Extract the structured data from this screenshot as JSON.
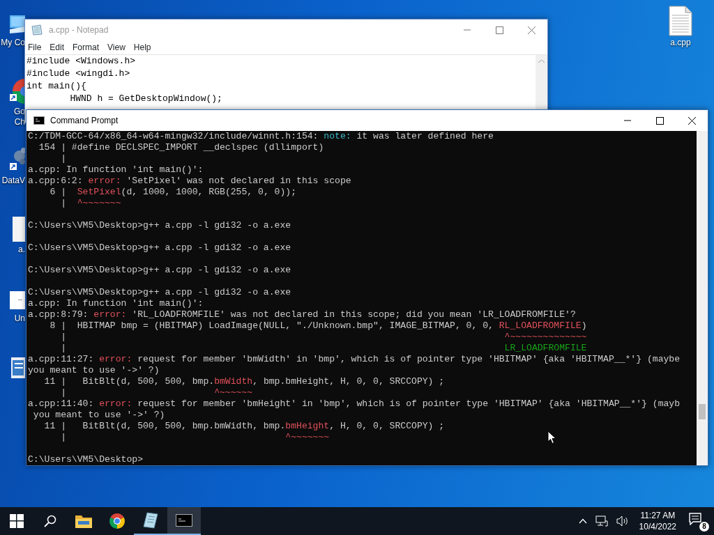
{
  "desktop_icons": [
    {
      "kind": "computer",
      "label_lines": [
        "My Co"
      ]
    },
    {
      "kind": "browser",
      "label_lines": [
        "Go",
        "Ch"
      ]
    },
    {
      "kind": "app",
      "label_lines": [
        "DataV"
      ]
    },
    {
      "kind": "file",
      "label_lines": [
        "a."
      ]
    },
    {
      "kind": "blank",
      "label_lines": [
        "Un"
      ]
    },
    {
      "kind": "doc"
    }
  ],
  "desktop_file": {
    "kind": "file",
    "label": "a.cpp"
  },
  "notepad": {
    "title": "a.cpp - Notepad",
    "menu": [
      "File",
      "Edit",
      "Format",
      "View",
      "Help"
    ],
    "lines": [
      "#include <Windows.h>",
      "#include <wingdi.h>",
      "int main(){",
      "        HWND h = GetDesktopWindow();"
    ]
  },
  "console": {
    "title": "Command Prompt",
    "lines": [
      {
        "kind": "text",
        "segments": [
          {
            "kind": "plain",
            "text": "C:/TDM-GCC-64/x86_64-w64-mingw32/include/winnt.h:154: "
          },
          {
            "kind": "note",
            "text": "note:"
          },
          {
            "kind": "plain",
            "text": " it was later defined here"
          }
        ]
      },
      {
        "kind": "text",
        "segments": [
          {
            "kind": "plain",
            "text": "  154 | #define DECLSPEC_IMPORT __declspec (dllimport)"
          }
        ]
      },
      {
        "kind": "text",
        "segments": [
          {
            "kind": "plain",
            "text": "      |"
          }
        ]
      },
      {
        "kind": "text",
        "segments": [
          {
            "kind": "plain",
            "text": "a.cpp: In function 'int main()':"
          }
        ]
      },
      {
        "kind": "text",
        "segments": [
          {
            "kind": "plain",
            "text": "a.cpp:6:2: "
          },
          {
            "kind": "error",
            "text": "error:"
          },
          {
            "kind": "plain",
            "text": " 'SetPixel' was not declared in this scope"
          }
        ]
      },
      {
        "kind": "text",
        "segments": [
          {
            "kind": "plain",
            "text": "    6 |  "
          },
          {
            "kind": "error",
            "text": "SetPixel"
          },
          {
            "kind": "plain",
            "text": "(d, 1000, 1000, RGB(255, 0, 0));"
          }
        ]
      },
      {
        "kind": "text",
        "segments": [
          {
            "kind": "plain",
            "text": "      |  "
          },
          {
            "kind": "error",
            "text": "^~~~~~~~"
          }
        ]
      },
      {
        "kind": "blank"
      },
      {
        "kind": "text",
        "segments": [
          {
            "kind": "plain",
            "text": "C:\\Users\\VM5\\Desktop>g++ a.cpp -l gdi32 -o a.exe"
          }
        ]
      },
      {
        "kind": "blank"
      },
      {
        "kind": "text",
        "segments": [
          {
            "kind": "plain",
            "text": "C:\\Users\\VM5\\Desktop>g++ a.cpp -l gdi32 -o a.exe"
          }
        ]
      },
      {
        "kind": "blank"
      },
      {
        "kind": "text",
        "segments": [
          {
            "kind": "plain",
            "text": "C:\\Users\\VM5\\Desktop>g++ a.cpp -l gdi32 -o a.exe"
          }
        ]
      },
      {
        "kind": "blank"
      },
      {
        "kind": "text",
        "segments": [
          {
            "kind": "plain",
            "text": "C:\\Users\\VM5\\Desktop>g++ a.cpp -l gdi32 -o a.exe"
          }
        ]
      },
      {
        "kind": "text",
        "segments": [
          {
            "kind": "plain",
            "text": "a.cpp: In function 'int main()':"
          }
        ]
      },
      {
        "kind": "text",
        "segments": [
          {
            "kind": "plain",
            "text": "a.cpp:8:79: "
          },
          {
            "kind": "error",
            "text": "error:"
          },
          {
            "kind": "plain",
            "text": " 'RL_LOADFROMFILE' was not declared in this scope; did you mean 'LR_LOADFROMFILE'?"
          }
        ]
      },
      {
        "kind": "text",
        "segments": [
          {
            "kind": "plain",
            "text": "    8 |  HBITMAP bmp = (HBITMAP) LoadImage(NULL, \"./Unknown.bmp\", IMAGE_BITMAP, 0, 0, "
          },
          {
            "kind": "error",
            "text": "RL_LOADFROMFILE"
          },
          {
            "kind": "plain",
            "text": ")"
          }
        ]
      },
      {
        "kind": "text",
        "segments": [
          {
            "kind": "plain",
            "text": "      |                                                                                "
          },
          {
            "kind": "error",
            "text": "^~~~~~~~~~~~~~~"
          }
        ]
      },
      {
        "kind": "text",
        "segments": [
          {
            "kind": "plain",
            "text": "      |                                                                                "
          },
          {
            "kind": "fix",
            "text": "LR_LOADFROMFILE"
          }
        ]
      },
      {
        "kind": "text",
        "segments": [
          {
            "kind": "plain",
            "text": "a.cpp:11:27: "
          },
          {
            "kind": "error",
            "text": "error:"
          },
          {
            "kind": "plain",
            "text": " request for member 'bmWidth' in 'bmp', which is of pointer type 'HBITMAP' {aka 'HBITMAP__*'} (maybe"
          }
        ]
      },
      {
        "kind": "text",
        "segments": [
          {
            "kind": "plain",
            "text": "you meant to use '->' ?)"
          }
        ]
      },
      {
        "kind": "text",
        "segments": [
          {
            "kind": "plain",
            "text": "   11 |   BitBlt(d, 500, 500, bmp."
          },
          {
            "kind": "error",
            "text": "bmWidth"
          },
          {
            "kind": "plain",
            "text": ", bmp.bmHeight, H, 0, 0, SRCCOPY) ;"
          }
        ]
      },
      {
        "kind": "text",
        "segments": [
          {
            "kind": "plain",
            "text": "      |                           "
          },
          {
            "kind": "error",
            "text": "^~~~~~~"
          }
        ]
      },
      {
        "kind": "text",
        "segments": [
          {
            "kind": "plain",
            "text": "a.cpp:11:40: "
          },
          {
            "kind": "error",
            "text": "error:"
          },
          {
            "kind": "plain",
            "text": " request for member 'bmHeight' in 'bmp', which is of pointer type 'HBITMAP' {aka 'HBITMAP__*'} (mayb"
          }
        ]
      },
      {
        "kind": "text",
        "segments": [
          {
            "kind": "plain",
            "text": " you meant to use '->' ?)"
          }
        ]
      },
      {
        "kind": "text",
        "segments": [
          {
            "kind": "plain",
            "text": "   11 |   BitBlt(d, 500, 500, bmp.bmWidth, bmp."
          },
          {
            "kind": "error",
            "text": "bmHeight"
          },
          {
            "kind": "plain",
            "text": ", H, 0, 0, SRCCOPY) ;"
          }
        ]
      },
      {
        "kind": "text",
        "segments": [
          {
            "kind": "plain",
            "text": "      |                                        "
          },
          {
            "kind": "error",
            "text": "^~~~~~~~"
          }
        ]
      },
      {
        "kind": "blank"
      },
      {
        "kind": "text",
        "segments": [
          {
            "kind": "plain",
            "text": "C:\\Users\\VM5\\Desktop>"
          }
        ]
      }
    ]
  },
  "taskbar": {
    "apps": [
      {
        "kind": "start",
        "running": false,
        "selected": false
      },
      {
        "kind": "search",
        "running": false,
        "selected": false
      },
      {
        "kind": "explorer",
        "running": false,
        "selected": false
      },
      {
        "kind": "browser",
        "running": false,
        "selected": false
      },
      {
        "kind": "notepad",
        "running": true,
        "selected": false
      },
      {
        "kind": "terminal",
        "running": true,
        "selected": true
      }
    ],
    "time": "11:27 AM",
    "date": "10/4/2022",
    "notifications": "8"
  }
}
